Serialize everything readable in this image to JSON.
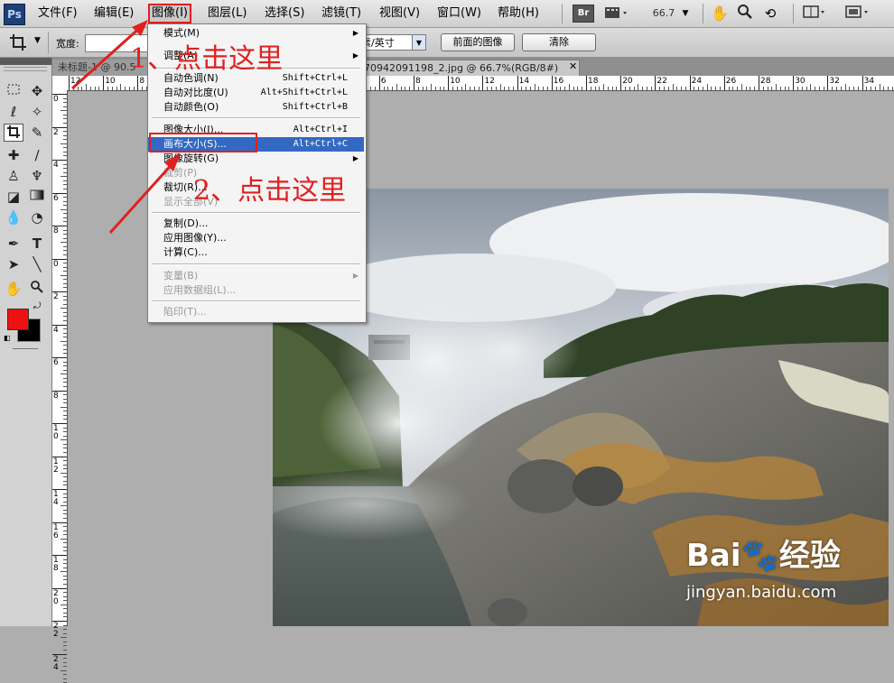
{
  "app": {
    "logo": "Ps"
  },
  "menubar": {
    "items": [
      {
        "label": "文件(F)"
      },
      {
        "label": "编辑(E)"
      },
      {
        "label": "图像(I)"
      },
      {
        "label": "图层(L)"
      },
      {
        "label": "选择(S)"
      },
      {
        "label": "滤镜(T)"
      },
      {
        "label": "视图(V)"
      },
      {
        "label": "窗口(W)"
      },
      {
        "label": "帮助(H)"
      }
    ],
    "bridge_label": "Br",
    "zoom": "66.7"
  },
  "options_bar": {
    "width_label": "宽度:",
    "resolution_unit": "素/英寸",
    "front_image_btn": "前面的图像",
    "clear_btn": "清除"
  },
  "doc_tabs": [
    {
      "label": "未标题-1 @ 90.5"
    },
    {
      "label": "70942091198_2.jpg @ 66.7%(RGB/8#)"
    }
  ],
  "ruler": {
    "h_labels": [
      "12",
      "10",
      "8",
      "6",
      "4",
      "2",
      "0",
      "2",
      "4",
      "6",
      "8",
      "10",
      "12",
      "14",
      "16",
      "18",
      "20",
      "22",
      "24",
      "26",
      "28",
      "30",
      "32",
      "34"
    ],
    "v_labels": [
      "0",
      "2",
      "4",
      "6",
      "8",
      "0",
      "2",
      "4",
      "6",
      "8",
      "10",
      "12",
      "14",
      "16",
      "18",
      "20",
      "22",
      "24"
    ]
  },
  "image_menu": {
    "items": [
      {
        "label": "模式(M)",
        "shortcut": "",
        "submenu": true,
        "disabled": false,
        "highlighted": false
      },
      {
        "label": "调整(A)",
        "shortcut": "",
        "submenu": true,
        "disabled": false,
        "highlighted": false
      },
      {
        "label": "自动色调(N)",
        "shortcut": "Shift+Ctrl+L",
        "submenu": false,
        "disabled": false,
        "highlighted": false
      },
      {
        "label": "自动对比度(U)",
        "shortcut": "Alt+Shift+Ctrl+L",
        "submenu": false,
        "disabled": false,
        "highlighted": false
      },
      {
        "label": "自动颜色(O)",
        "shortcut": "Shift+Ctrl+B",
        "submenu": false,
        "disabled": false,
        "highlighted": false
      },
      {
        "label": "图像大小(I)...",
        "shortcut": "Alt+Ctrl+I",
        "submenu": false,
        "disabled": false,
        "highlighted": false
      },
      {
        "label": "画布大小(S)...",
        "shortcut": "Alt+Ctrl+C",
        "submenu": false,
        "disabled": false,
        "highlighted": true
      },
      {
        "label": "图像旋转(G)",
        "shortcut": "",
        "submenu": true,
        "disabled": false,
        "highlighted": false
      },
      {
        "label": "裁剪(P)",
        "shortcut": "",
        "submenu": false,
        "disabled": true,
        "highlighted": false
      },
      {
        "label": "裁切(R)...",
        "shortcut": "",
        "submenu": false,
        "disabled": false,
        "highlighted": false
      },
      {
        "label": "显示全部(V)",
        "shortcut": "",
        "submenu": false,
        "disabled": true,
        "highlighted": false
      },
      {
        "label": "复制(D)...",
        "shortcut": "",
        "submenu": false,
        "disabled": false,
        "highlighted": false
      },
      {
        "label": "应用图像(Y)...",
        "shortcut": "",
        "submenu": false,
        "disabled": false,
        "highlighted": false
      },
      {
        "label": "计算(C)...",
        "shortcut": "",
        "submenu": false,
        "disabled": false,
        "highlighted": false
      },
      {
        "label": "变量(B)",
        "shortcut": "",
        "submenu": true,
        "disabled": true,
        "highlighted": false
      },
      {
        "label": "应用数据组(L)...",
        "shortcut": "",
        "submenu": false,
        "disabled": true,
        "highlighted": false
      },
      {
        "label": "陷印(T)...",
        "shortcut": "",
        "submenu": false,
        "disabled": true,
        "highlighted": false
      }
    ]
  },
  "annotations": {
    "step1": "1、点击这里",
    "step2": "2、点击这里",
    "color": "#e02020"
  },
  "watermark": {
    "brand": "Bai",
    "brand2": "经验",
    "url": "jingyan.baidu.com"
  },
  "colors": {
    "foreground": "#ee1111",
    "background": "#000000",
    "highlight": "#3369c3"
  }
}
